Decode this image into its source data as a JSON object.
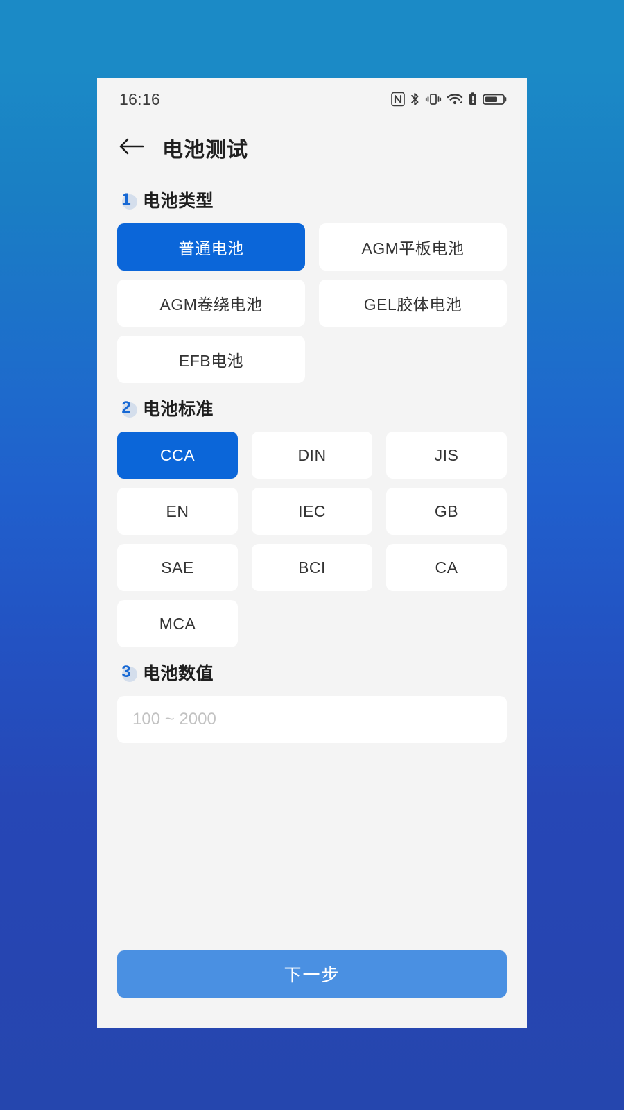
{
  "status_bar": {
    "time": "16:16",
    "icons": [
      "nfc-icon",
      "bluetooth-icon",
      "vibrate-icon",
      "wifi-icon",
      "battery-alert-icon",
      "battery-icon"
    ]
  },
  "header": {
    "back_icon": "back-arrow-icon",
    "title": "电池测试"
  },
  "sections": [
    {
      "number": "1",
      "title": "电池类型",
      "columns": 2,
      "options": [
        {
          "label": "普通电池",
          "selected": true
        },
        {
          "label": "AGM平板电池",
          "selected": false
        },
        {
          "label": "AGM卷绕电池",
          "selected": false
        },
        {
          "label": "GEL胶体电池",
          "selected": false
        },
        {
          "label": "EFB电池",
          "selected": false
        }
      ]
    },
    {
      "number": "2",
      "title": "电池标准",
      "columns": 3,
      "options": [
        {
          "label": "CCA",
          "selected": true
        },
        {
          "label": "DIN",
          "selected": false
        },
        {
          "label": "JIS",
          "selected": false
        },
        {
          "label": "EN",
          "selected": false
        },
        {
          "label": "IEC",
          "selected": false
        },
        {
          "label": "GB",
          "selected": false
        },
        {
          "label": "SAE",
          "selected": false
        },
        {
          "label": "BCI",
          "selected": false
        },
        {
          "label": "CA",
          "selected": false
        },
        {
          "label": "MCA",
          "selected": false
        }
      ]
    },
    {
      "number": "3",
      "title": "电池数值",
      "input": {
        "placeholder": "100 ~ 2000",
        "value": ""
      }
    }
  ],
  "footer": {
    "next_label": "下一步"
  },
  "colors": {
    "accent_selected": "#0b66d9",
    "accent_step_number": "#1668d4",
    "next_button": "#4a90e2",
    "screen_bg": "#f4f4f4",
    "card_bg": "#ffffff",
    "backdrop_top": "#1b8ac6",
    "backdrop_bottom": "#2546ae"
  }
}
